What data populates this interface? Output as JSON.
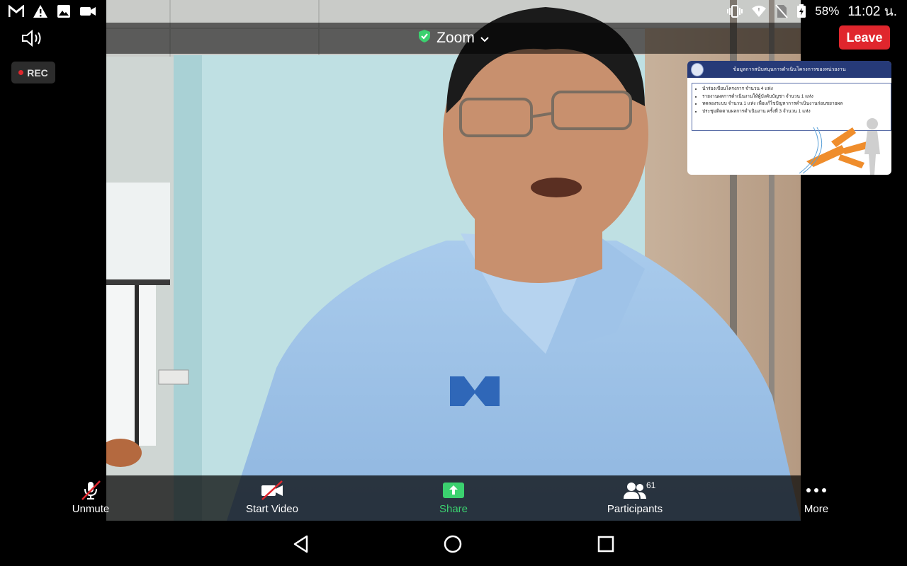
{
  "status_bar": {
    "left_icons": [
      "gmail-icon",
      "warning-icon",
      "image-icon",
      "video-camera-icon"
    ],
    "battery": "58%",
    "time": "11:02 น.",
    "right_icons": [
      "vibrate-icon",
      "wifi-icon",
      "no-sim-icon",
      "battery-icon"
    ]
  },
  "top_bar": {
    "title": "Zoom",
    "title_icon": "shield-check-icon",
    "leave_label": "Leave",
    "speaker_icon": "speaker-icon"
  },
  "recording": {
    "label": "REC"
  },
  "shared_content": {
    "header": "ข้อมูลการสนับสนุนการดำเนินโครงการของหน่วยงาน",
    "bullets": [
      "นำร่องเขียนโครงการ จำนวน 4 แห่ง",
      "รายงานผลการดำเนินงานให้ผู้บังคับบัญชา จำนวน 1 แห่ง",
      "ทดลองระบบ จำนวน 1 แห่ง เพื่อแก้ไขปัญหาการดำเนินงานก่อนขยายผล",
      "ประชุมติดตามผลการดำเนินงาน ครั้งที่ 3 จำนวน 1 แห่ง"
    ]
  },
  "toolbar": {
    "buttons": [
      {
        "label": "Unmute",
        "icon": "microphone-muted-icon"
      },
      {
        "label": "Start Video",
        "icon": "video-off-icon"
      },
      {
        "label": "Share",
        "icon": "share-screen-icon"
      },
      {
        "label": "Participants",
        "icon": "participants-icon",
        "count": "61"
      },
      {
        "label": "More",
        "icon": "more-dots-icon"
      }
    ],
    "share_color": "#3bd16f"
  },
  "nav_bar": {
    "buttons": [
      "back-icon",
      "home-icon",
      "recents-icon"
    ]
  },
  "colors": {
    "leave": "#e0262d",
    "accent_green": "#3bd16f",
    "rec_dot": "#e0262d"
  }
}
